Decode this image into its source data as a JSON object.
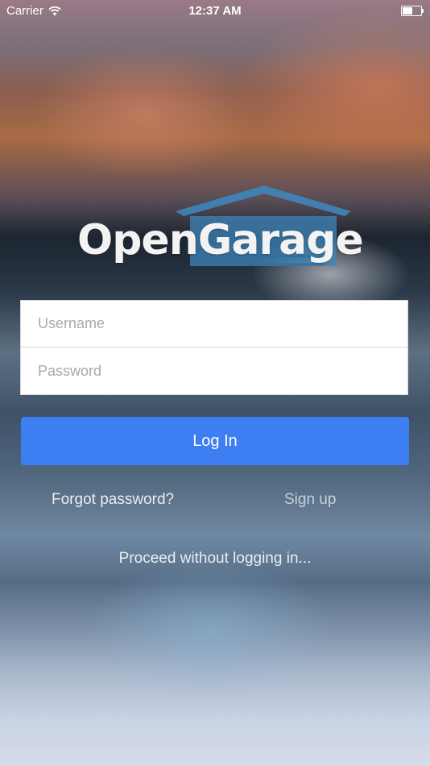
{
  "status_bar": {
    "carrier": "Carrier",
    "time": "12:37 AM"
  },
  "logo": {
    "text": "OpenGarage",
    "icon": "garage-icon",
    "icon_color": "#3f84b8"
  },
  "login_form": {
    "username_placeholder": "Username",
    "password_placeholder": "Password"
  },
  "actions": {
    "login_label": "Log In",
    "forgot_password_label": "Forgot password?",
    "signup_label": "Sign up",
    "proceed_label": "Proceed without logging in..."
  },
  "colors": {
    "primary_button": "#3d7ff2",
    "link_text": "#e9eef4"
  }
}
